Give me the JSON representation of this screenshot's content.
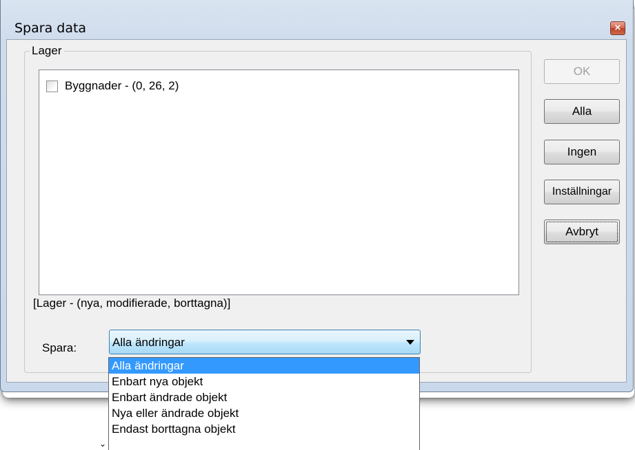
{
  "window": {
    "title": "Spara data",
    "close_glyph": "×"
  },
  "group": {
    "label": "Lager"
  },
  "layers": [
    {
      "label": "Byggnader - (0, 26, 2)",
      "checked": false
    }
  ],
  "legend_text": "[Lager - (nya, modifierade, borttagna)]",
  "save": {
    "label": "Spara:",
    "selected": "Alla ändringar",
    "options": [
      "Alla ändringar",
      "Enbart nya objekt",
      "Enbart ändrade objekt",
      "Nya eller ändrade objekt",
      "Endast borttagna objekt"
    ]
  },
  "buttons": {
    "ok": "OK",
    "all": "Alla",
    "none": "Ingen",
    "settings": "Inställningar",
    "cancel": "Avbryt"
  },
  "colors": {
    "selection": "#3399ff",
    "combo_border": "#3c7fb1",
    "close_button": "#c74d36"
  }
}
